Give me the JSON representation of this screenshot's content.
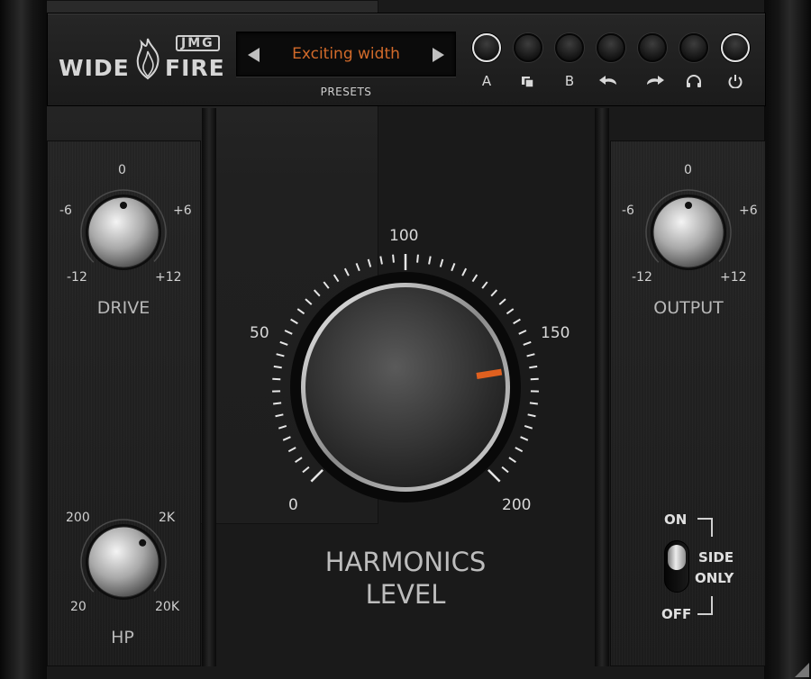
{
  "app": {
    "logo_word_left": "WIDE",
    "logo_word_right": "FIRE",
    "brand": "JMG"
  },
  "presets": {
    "current": "Exciting width",
    "label": "PRESETS"
  },
  "toolbar": [
    {
      "name": "a-button",
      "label": "A",
      "icon": null,
      "highlighted": true
    },
    {
      "name": "copy-button",
      "label": "",
      "icon": "copy-icon",
      "highlighted": false
    },
    {
      "name": "b-button",
      "label": "B",
      "icon": null,
      "highlighted": false
    },
    {
      "name": "undo-button",
      "label": "",
      "icon": "undo-icon",
      "highlighted": false
    },
    {
      "name": "redo-button",
      "label": "",
      "icon": "redo-icon",
      "highlighted": false
    },
    {
      "name": "headphones-button",
      "label": "",
      "icon": "headphones-icon",
      "highlighted": false
    },
    {
      "name": "power-button",
      "label": "",
      "icon": "power-icon",
      "highlighted": true
    }
  ],
  "drive": {
    "caption": "DRIVE",
    "ticks": {
      "top": "0",
      "left": "-6",
      "right": "+6",
      "bottom_left": "-12",
      "bottom_right": "+12"
    },
    "value": 0
  },
  "output": {
    "caption": "OUTPUT",
    "ticks": {
      "top": "0",
      "left": "-6",
      "right": "+6",
      "bottom_left": "-12",
      "bottom_right": "+12"
    },
    "value": 0
  },
  "hp": {
    "caption": "HP",
    "ticks": {
      "top_left": "200",
      "top_right": "2K",
      "bottom_left": "20",
      "bottom_right": "20K"
    }
  },
  "harmonics": {
    "caption_line1": "HARMONICS",
    "caption_line2": "LEVEL",
    "ticks": {
      "t0": "0",
      "t50": "50",
      "t100": "100",
      "t150": "150",
      "t200": "200"
    },
    "value": 160,
    "min": 0,
    "max": 200,
    "accent": "#e0601f"
  },
  "side_only": {
    "on_label": "ON",
    "off_label": "OFF",
    "label_line1": "SIDE",
    "label_line2": "ONLY",
    "state": "on"
  },
  "colors": {
    "preset_text": "#d26a2a",
    "pointer": "#e0601f"
  }
}
